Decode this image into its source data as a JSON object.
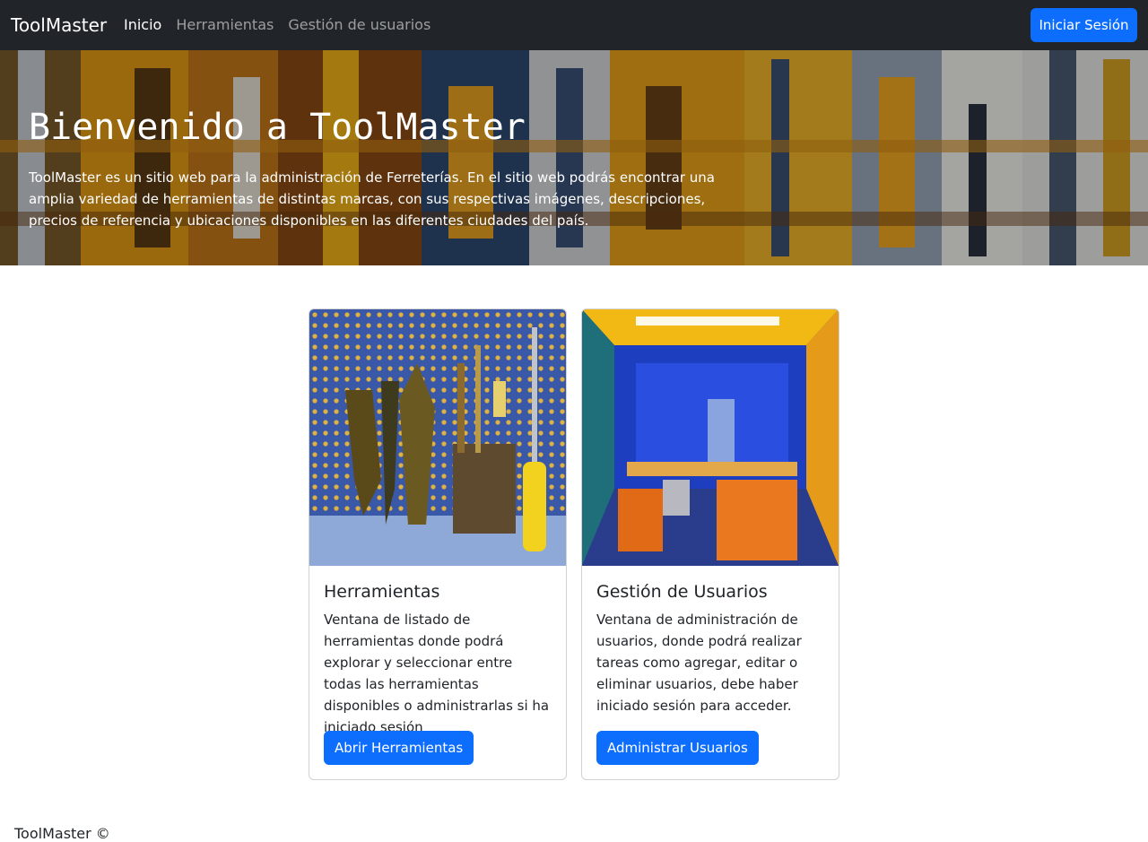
{
  "navbar": {
    "brand": "ToolMaster",
    "links": [
      {
        "label": "Inicio",
        "active": true
      },
      {
        "label": "Herramientas",
        "active": false
      },
      {
        "label": "Gestión de usuarios",
        "active": false
      }
    ],
    "login_label": "Iniciar Sesión"
  },
  "hero": {
    "title": "Bienvenido a ToolMaster",
    "text": "ToolMaster es un sitio web para la administración de Ferreterías. En el sitio web podrás encontrar una amplia variedad de herramientas de distintas marcas, con sus respectivas imágenes, descripciones, precios de referencia y ubicaciones disponibles en las diferentes ciudades del país."
  },
  "cards": [
    {
      "title": "Herramientas",
      "text": "Ventana de listado de herramientas donde podrá explorar y seleccionar entre todas las herramientas disponibles o administrarlas si ha iniciado sesión",
      "button": "Abrir Herramientas"
    },
    {
      "title": "Gestión de Usuarios",
      "text": "Ventana de administración de usuarios, donde podrá realizar tareas como agregar, editar o eliminar usuarios, debe haber iniciado sesión para acceder.",
      "button": "Administrar Usuarios"
    }
  ],
  "footer": {
    "text": "ToolMaster ©"
  },
  "colors": {
    "navbar_bg": "#212529",
    "primary": "#0d6efd",
    "text": "#212529"
  }
}
